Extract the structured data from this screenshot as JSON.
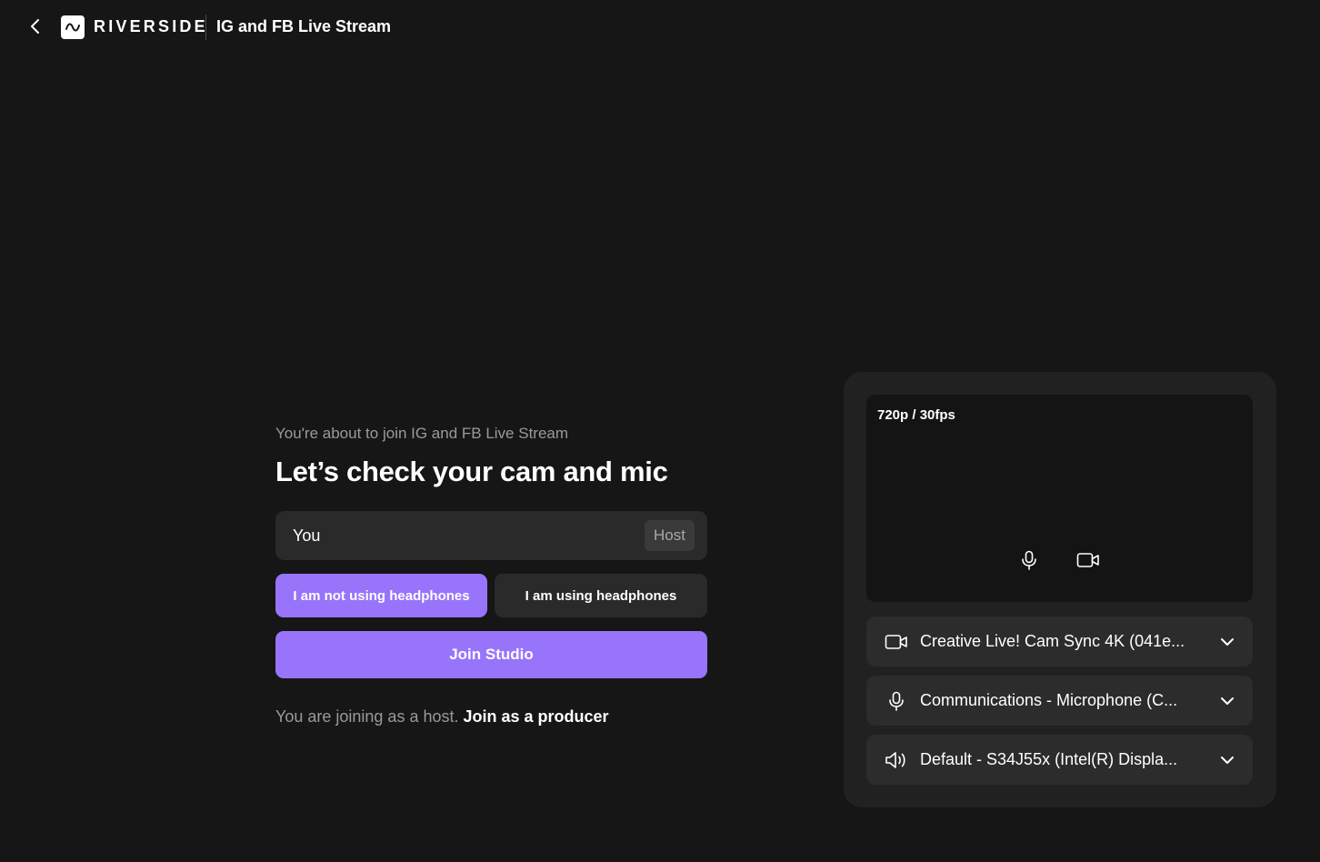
{
  "header": {
    "brand": "RIVERSIDE",
    "studio_name": "IG and FB Live Stream"
  },
  "join": {
    "subtitle": "You're about to join IG and FB Live Stream",
    "headline": "Let’s check your cam and mic",
    "name_value": "You",
    "role_badge": "Host",
    "headphones_off_label": "I am not using headphones",
    "headphones_on_label": "I am using headphones",
    "join_button": "Join Studio",
    "note_prefix": "You are joining as a host.",
    "note_link": "Join as a producer"
  },
  "preview": {
    "quality": "720p / 30fps"
  },
  "devices": {
    "camera": "Creative Live! Cam Sync 4K (041e...",
    "microphone": "Communications - Microphone (C...",
    "speaker": "Default - S34J55x (Intel(R) Displa..."
  },
  "colors": {
    "background": "#161616",
    "accent": "#9874fb",
    "panel": "#212121",
    "field": "#2a2a2a"
  }
}
